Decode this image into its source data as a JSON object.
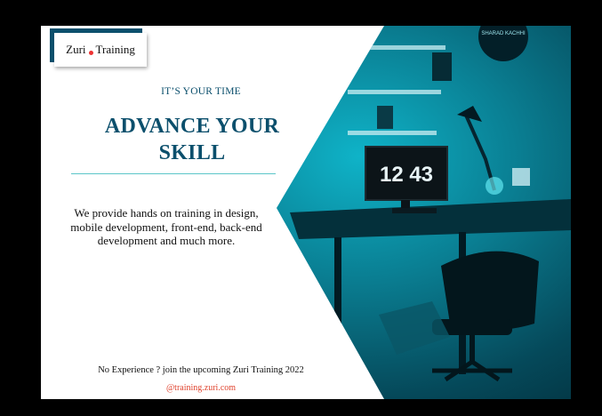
{
  "brand": {
    "name_left": "Zuri",
    "name_right": "Training"
  },
  "kicker": "IT’S YOUR TIME",
  "headline": {
    "line1": "ADVANCE YOUR",
    "line2": "SKILL"
  },
  "description": "We provide hands on training in design, mobile development, front-end, back-end development and much more.",
  "footer": "No Experience ? join the upcoming  Zuri Training 2022",
  "handle": "@training.zuri.com",
  "photo": {
    "clock_text": "12 43",
    "poster_text": "SHARAD KACHHI"
  },
  "colors": {
    "accent": "#0b4f6c",
    "teal": "#0fb3c8",
    "handle": "#e0442f",
    "rule": "#5cc6c8"
  }
}
